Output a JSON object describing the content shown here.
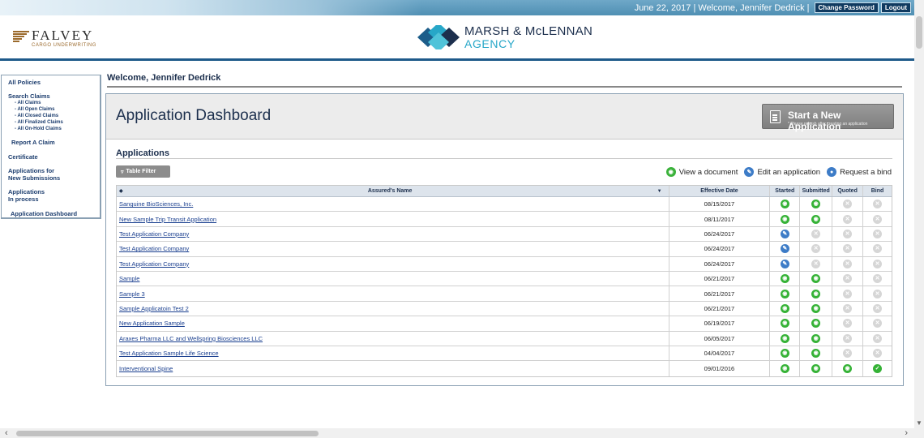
{
  "topbar": {
    "greeting": "June 22, 2017 | Welcome, Jennifer Dedrick |",
    "change_password": "Change Password",
    "logout": "Logout"
  },
  "header": {
    "falvey_name": "FALVEY",
    "falvey_sub": "CARGO UNDERWRITING",
    "mm_name": "MARSH & McLENNAN",
    "mm_sub": "AGENCY"
  },
  "sidebar": {
    "all_policies": "All Policies",
    "search_claims": "Search Claims",
    "claims_subs": [
      "- All Claims",
      "- All Open Claims",
      "- All Closed Claims",
      "- All Finalized Claims",
      "- All On-Hold Claims"
    ],
    "report_claim": "Report A Claim",
    "certificate": "Certificate",
    "apps_new_1": "Applications for",
    "apps_new_2": "New Submissions",
    "apps_process_1": "Applications",
    "apps_process_2": "In process",
    "dashboard": "Application Dashboard"
  },
  "main": {
    "welcome": "Welcome, Jennifer Dedrick",
    "title": "Application Dashboard",
    "start_button": "Start a New Application",
    "start_note": "* Please refresh after creating an application",
    "applications_heading": "Applications",
    "table_filter": "Table Filter",
    "legend": {
      "view": "View a document",
      "edit": "Edit an application",
      "bind": "Request a bind"
    }
  },
  "table": {
    "headers": {
      "name": "Assured's Name",
      "date": "Effective Date",
      "started": "Started",
      "submitted": "Submitted",
      "quoted": "Quoted",
      "bind": "Bind"
    },
    "rows": [
      {
        "name": "Sanguine BioSciences, Inc.",
        "date": "08/15/2017",
        "started": "view",
        "submitted": "view",
        "quoted": "na",
        "bind": "na"
      },
      {
        "name": "New Sample Trip Transit Application",
        "date": "08/11/2017",
        "started": "view",
        "submitted": "view",
        "quoted": "na",
        "bind": "na"
      },
      {
        "name": "Test Application Company",
        "date": "06/24/2017",
        "started": "edit",
        "submitted": "na",
        "quoted": "na",
        "bind": "na"
      },
      {
        "name": "Test Application Company",
        "date": "06/24/2017",
        "started": "edit",
        "submitted": "na",
        "quoted": "na",
        "bind": "na"
      },
      {
        "name": "Test Application Company",
        "date": "06/24/2017",
        "started": "edit",
        "submitted": "na",
        "quoted": "na",
        "bind": "na"
      },
      {
        "name": "Sample",
        "date": "06/21/2017",
        "started": "view",
        "submitted": "view",
        "quoted": "na",
        "bind": "na"
      },
      {
        "name": "Sample 3",
        "date": "06/21/2017",
        "started": "view",
        "submitted": "view",
        "quoted": "na",
        "bind": "na"
      },
      {
        "name": "Sample Applicatoin Test 2",
        "date": "06/21/2017",
        "started": "view",
        "submitted": "view",
        "quoted": "na",
        "bind": "na"
      },
      {
        "name": "New Application Sample",
        "date": "06/19/2017",
        "started": "view",
        "submitted": "view",
        "quoted": "na",
        "bind": "na"
      },
      {
        "name": "Araxes Pharma LLC and Wellspring Biosciences LLC",
        "date": "06/05/2017",
        "started": "view",
        "submitted": "view",
        "quoted": "na",
        "bind": "na"
      },
      {
        "name": "Test Application Sample Life Science",
        "date": "04/04/2017",
        "started": "view",
        "submitted": "view",
        "quoted": "na",
        "bind": "na"
      },
      {
        "name": "Interventional Spine",
        "date": "09/01/2016",
        "started": "view",
        "submitted": "view",
        "quoted": "view",
        "bind": "done"
      }
    ]
  },
  "colors": {
    "navy": "#1c2f4d",
    "accent_blue": "#1e5a8a",
    "teal": "#27a7c8",
    "status_green": "#35b236",
    "edit_blue": "#3d7cc7",
    "inactive_grey": "#d6d6d6"
  },
  "icons": {
    "view": "eye-icon",
    "edit": "pencil-icon",
    "bind": "user-icon",
    "na": "x-circle-icon",
    "done": "check-icon"
  }
}
